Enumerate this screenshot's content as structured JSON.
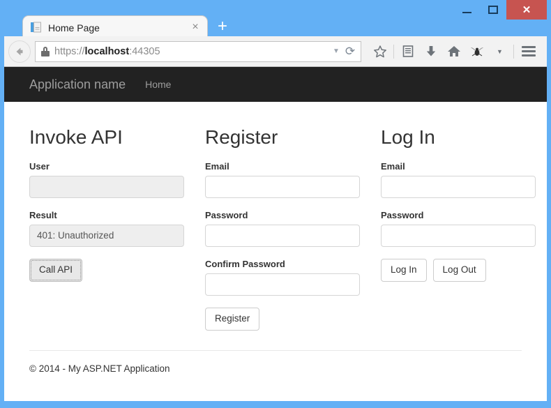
{
  "browser": {
    "tab": {
      "title": "Home Page",
      "favicon_icon": "page-document-icon",
      "close_icon": "×"
    },
    "new_tab_label": "+",
    "window_controls": {
      "minimize_icon": "minimize-icon",
      "maximize_icon": "maximize-icon",
      "close_label": "✕"
    },
    "toolbar": {
      "back_icon": "back-arrow-icon",
      "lock_icon": "padlock-icon",
      "url_scheme": "https://",
      "url_host": "localhost",
      "url_port": ":44305",
      "url_full": "https://localhost:44305",
      "dropdown_icon": "▼",
      "reload_icon": "⟳",
      "bookmark_icon": "☆",
      "reader_icon": "reader-list-icon",
      "downloads_icon": "⬇",
      "home_icon": "home-icon",
      "firebug_icon": "bug-icon",
      "overflow_icon": "▼",
      "menu_icon": "hamburger-menu-icon"
    }
  },
  "page": {
    "navbar": {
      "brand": "Application name",
      "links": [
        {
          "label": "Home"
        }
      ]
    },
    "columns": [
      {
        "title": "Invoke API",
        "fields": [
          {
            "label": "User",
            "value": "",
            "readonly": true
          },
          {
            "label": "Result",
            "value": "401: Unauthorized",
            "readonly": true
          }
        ],
        "buttons": [
          {
            "label": "Call API",
            "focused": true
          }
        ]
      },
      {
        "title": "Register",
        "fields": [
          {
            "label": "Email",
            "value": "",
            "readonly": false
          },
          {
            "label": "Password",
            "value": "",
            "readonly": false
          },
          {
            "label": "Confirm Password",
            "value": "",
            "readonly": false
          }
        ],
        "buttons": [
          {
            "label": "Register",
            "focused": false
          }
        ]
      },
      {
        "title": "Log In",
        "fields": [
          {
            "label": "Email",
            "value": "",
            "readonly": false
          },
          {
            "label": "Password",
            "value": "",
            "readonly": false
          }
        ],
        "buttons": [
          {
            "label": "Log In",
            "focused": false
          },
          {
            "label": "Log Out",
            "focused": false
          }
        ]
      }
    ],
    "footer": {
      "copyright": "© 2014 - My ASP.NET Application"
    }
  },
  "colors": {
    "window_frame": "#63b0f5",
    "close_button": "#c75450",
    "navbar_bg": "#222222",
    "navbar_text": "#9d9d9d",
    "readonly_field": "#eeeeee"
  }
}
